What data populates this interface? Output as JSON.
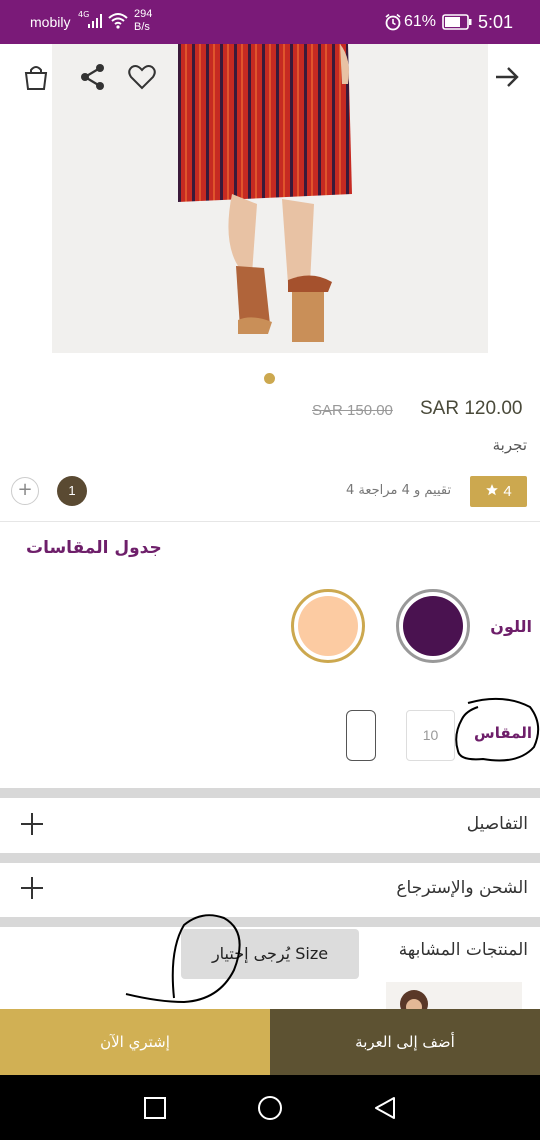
{
  "status_bar": {
    "carrier": "mobily",
    "network": "4G",
    "speed_value": "294",
    "speed_unit": "B/s",
    "battery": "61%",
    "time": "5:01"
  },
  "header": {
    "icons": [
      "cart-icon",
      "share-icon",
      "heart-icon",
      "arrow-right-icon"
    ]
  },
  "product": {
    "price": "SAR 120.00",
    "old_price": "SAR 150.00",
    "brand": "تجربة",
    "rating": "4",
    "reviews_text": "4 تقييم و 4 مراجعة",
    "quantity": "1",
    "quantity_minus": "+"
  },
  "size_chart_label": "جدول المقاسات",
  "color": {
    "label": "اللون",
    "options": [
      "#4a1250",
      "#fccba2"
    ]
  },
  "size": {
    "label": "المقاس",
    "options": [
      "10"
    ]
  },
  "accordions": [
    {
      "label": "التفاصيل"
    },
    {
      "label": "الشحن والإسترجاع"
    }
  ],
  "similar_products_title": "المنتجات المشابهة",
  "toast": "يُرجى إختيار Size",
  "actions": {
    "buy_now": "إشتري الآن",
    "add_to_cart": "أضف إلى العربة"
  },
  "colors": {
    "status_bar": "#7a1a78",
    "brand_purple": "#6e1f6a",
    "gold": "#d1b054",
    "dark_olive": "#5d5232"
  }
}
